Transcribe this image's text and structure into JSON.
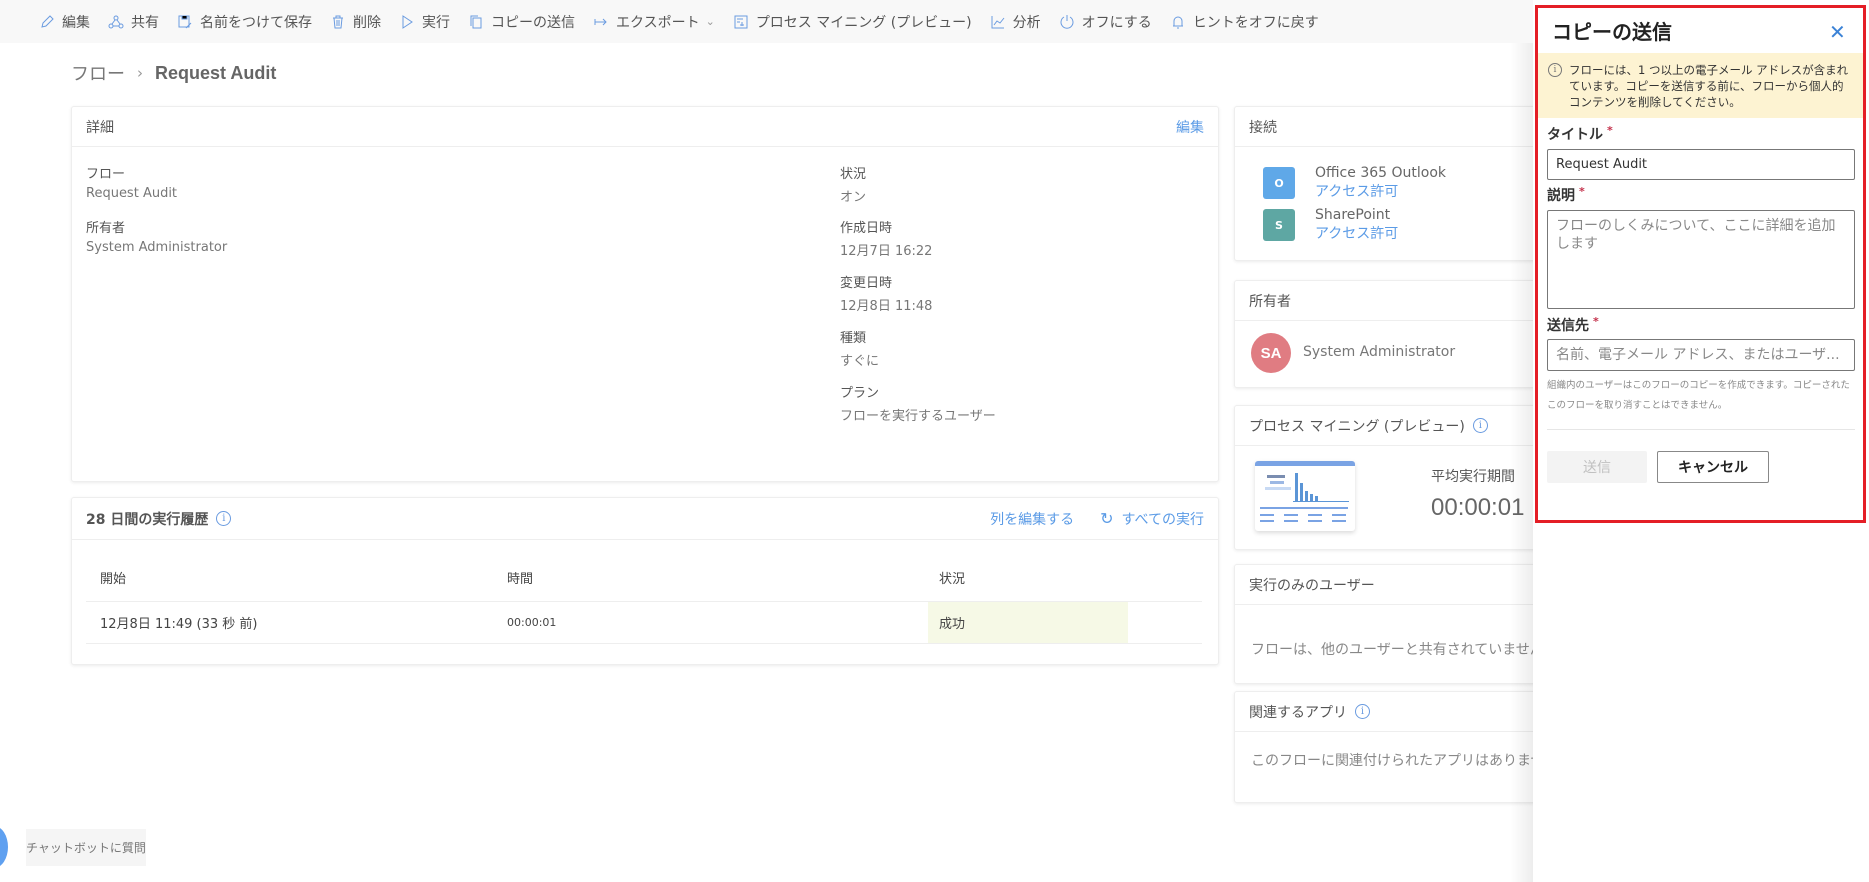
{
  "toolbar": {
    "items": [
      {
        "label": "編集",
        "icon": "pencil-icon"
      },
      {
        "label": "共有",
        "icon": "share-icon"
      },
      {
        "label": "名前をつけて保存",
        "icon": "save-as-icon"
      },
      {
        "label": "削除",
        "icon": "trash-icon"
      },
      {
        "label": "実行",
        "icon": "play-icon"
      },
      {
        "label": "コピーの送信",
        "icon": "copy-icon"
      },
      {
        "label": "エクスポート",
        "icon": "export-arrow-icon"
      },
      {
        "label": "プロセス マイニング (プレビュー)",
        "icon": "process-mining-icon"
      },
      {
        "label": "分析",
        "icon": "chart-icon"
      },
      {
        "label": "オフにする",
        "icon": "power-icon"
      },
      {
        "label": "ヒントをオフに戻す",
        "icon": "bell-icon"
      }
    ]
  },
  "breadcrumb": {
    "root": "フロー",
    "current": "Request Audit"
  },
  "details": {
    "title": "詳細",
    "edit_link": "編集",
    "left": [
      {
        "key": "フロー",
        "value": "Request Audit"
      },
      {
        "key": "所有者",
        "value": "System Administrator"
      }
    ],
    "right": [
      {
        "key": "状況",
        "value": "オン"
      },
      {
        "key": "作成日時",
        "value": "12月7日 16:22"
      },
      {
        "key": "変更日時",
        "value": "12月8日 11:48"
      },
      {
        "key": "種類",
        "value": "すぐに"
      },
      {
        "key": "プラン",
        "value": "フローを実行するユーザー"
      }
    ]
  },
  "history": {
    "title": "28 日間の実行履歴",
    "edit_columns": "列を編集する",
    "all_runs": "すべての実行",
    "columns": [
      "開始",
      "時間",
      "状況"
    ],
    "rows": [
      {
        "start": "12月8日 11:49 (33 秒 前)",
        "duration": "00:00:01",
        "status": "成功"
      }
    ]
  },
  "connections": {
    "title": "接続",
    "items": [
      {
        "name": "Office 365 Outlook",
        "link": "アクセス許可",
        "color": "#5fa8e8"
      },
      {
        "name": "SharePoint",
        "link": "アクセス許可",
        "color": "#5ea7a3"
      }
    ]
  },
  "owners": {
    "title": "所有者",
    "initials": "SA",
    "name": "System Administrator"
  },
  "process_mining": {
    "title": "プロセス マイニング (プレビュー)",
    "avg_label": "平均実行期間",
    "avg_value": "00:00:01"
  },
  "run_only": {
    "title": "実行のみのユーザー",
    "text": "フローは、他のユーザーと共有されていません。"
  },
  "related_apps": {
    "title": "関連するアプリ",
    "text": "このフローに関連付けられたアプリはありません。"
  },
  "chatbot": {
    "label": "チャットボットに質問"
  },
  "panel": {
    "title": "コピーの送信",
    "warning": "フローには、1 つ以上の電子メール アドレスが含まれています。コピーを送信する前に、フローから個人的コンテンツを削除してください。",
    "title_label": "タイトル",
    "title_value": "Request Audit",
    "desc_label": "説明",
    "desc_placeholder": "フローのしくみについて、ここに詳細を追加します",
    "to_label": "送信先",
    "to_placeholder": "名前、電子メール アドレス、またはユーザ...",
    "help": "組織内のユーザーはこのフローのコピーを作成できます。コピーされたこのフローを取り消すことはできません。",
    "required_mark": "*",
    "send": "送信",
    "cancel": "キャンセル"
  }
}
